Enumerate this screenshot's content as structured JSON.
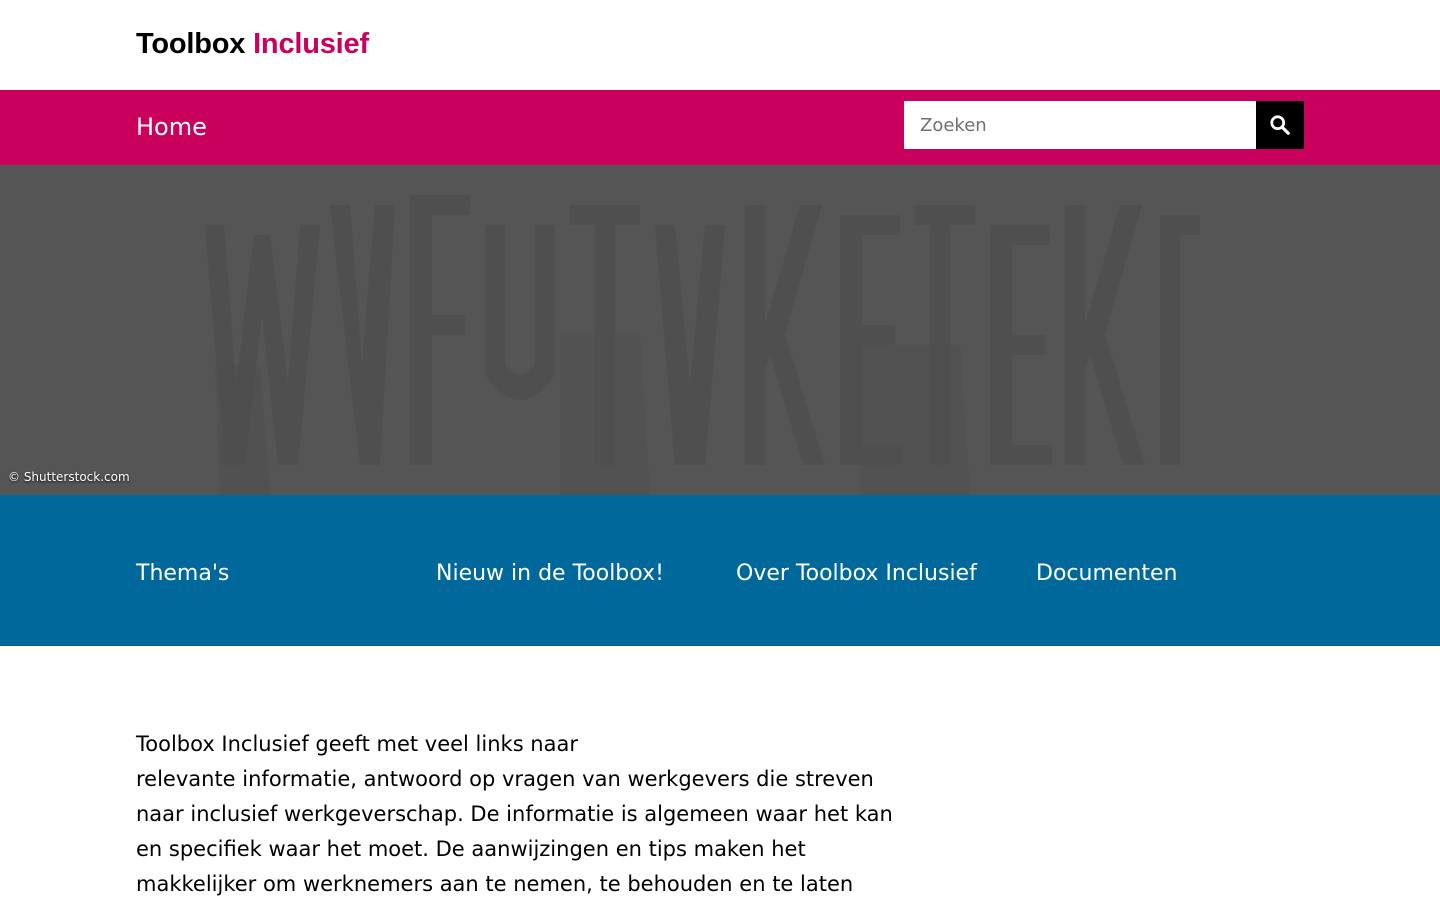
{
  "header": {
    "logo_part1": "Toolbox",
    "logo_part2": "Inclusief"
  },
  "nav": {
    "home_label": "Home",
    "search_placeholder": "Zoeken",
    "search_icon": "magnifier-icon"
  },
  "hero": {
    "credit": "© Shutterstock.com"
  },
  "quicklinks": [
    {
      "label": "Thema's"
    },
    {
      "label": "Nieuw in de Toolbox!"
    },
    {
      "label": "Over Toolbox Inclusief"
    },
    {
      "label": "Documenten"
    }
  ],
  "intro": {
    "lines": [
      "Toolbox Inclusief geeft met veel links naar",
      "relevante informatie, antwoord op vragen van werkgevers die streven",
      "naar inclusief werkgeverschap. De informatie is algemeen waar het kan",
      "en specifiek waar het moet. De aanwijzingen en tips maken het",
      "makkelijker om werknemers aan te nemen, te behouden en te laten"
    ]
  },
  "colors": {
    "brand_pink": "#ca005d",
    "brand_blue": "#01689b",
    "hero_gray": "#555555"
  }
}
